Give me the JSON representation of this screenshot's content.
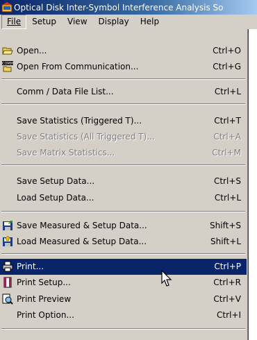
{
  "window": {
    "title": "Optical Disk Inter-Symbol Interference Analysis So"
  },
  "menubar": [
    {
      "label": "File"
    },
    {
      "label": "Setup"
    },
    {
      "label": "View"
    },
    {
      "label": "Display"
    },
    {
      "label": "Help"
    }
  ],
  "file_menu": {
    "open": {
      "label": "Open...",
      "accel": "Ctrl+O",
      "icon": "open-folder-icon"
    },
    "open_comm": {
      "label": "Open From Communication...",
      "accel": "Ctrl+G",
      "icon": "comm-icon"
    },
    "comm_list": {
      "label": "Comm / Data File List...",
      "accel": "Ctrl+L"
    },
    "save_stats": {
      "label": "Save Statistics (Triggered T)...",
      "accel": "Ctrl+T"
    },
    "save_stats_all": {
      "label": "Save Statistics (All Triggered T)...",
      "accel": "Ctrl+A"
    },
    "save_matrix": {
      "label": "Save Matrix Statistics...",
      "accel": "Ctrl+M"
    },
    "save_setup": {
      "label": "Save Setup Data...",
      "accel": "Ctrl+S"
    },
    "load_setup": {
      "label": "Load Setup Data...",
      "accel": "Ctrl+L"
    },
    "save_measured": {
      "label": "Save Measured & Setup Data...",
      "accel": "Shift+S",
      "icon": "save-measured-icon"
    },
    "load_measured": {
      "label": "Load Measured & Setup Data...",
      "accel": "Shift+L",
      "icon": "load-measured-icon"
    },
    "print": {
      "label": "Print...",
      "accel": "Ctrl+P",
      "icon": "printer-icon"
    },
    "print_setup": {
      "label": "Print Setup...",
      "accel": "Ctrl+R",
      "icon": "page-setup-icon"
    },
    "print_preview": {
      "label": "Print Preview",
      "accel": "Ctrl+V",
      "icon": "print-preview-icon"
    },
    "print_option": {
      "label": "Print Option...",
      "accel": "Ctrl+I"
    }
  },
  "colors": {
    "highlight": "#0a246a",
    "menu_bg": "#d4d0c8",
    "disabled": "#808080"
  }
}
